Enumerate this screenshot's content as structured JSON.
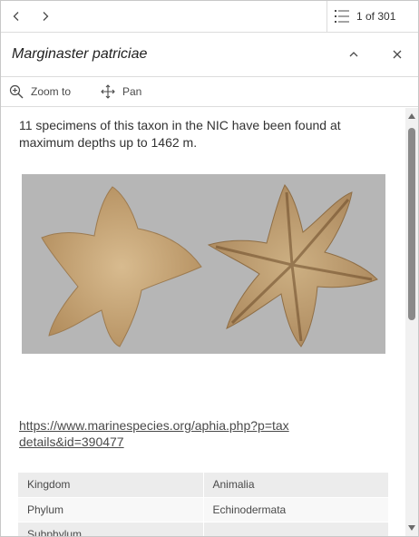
{
  "pager": {
    "prev_icon": "chevron-left-icon",
    "next_icon": "chevron-right-icon",
    "list_icon": "list-icon",
    "count_text": "1 of 301"
  },
  "header": {
    "title": "Marginaster patriciae",
    "collapse_icon": "chevron-up-icon",
    "close_icon": "close-icon"
  },
  "actions": {
    "zoom_label": "Zoom to",
    "pan_label": "Pan"
  },
  "content": {
    "description": "11 specimens of this taxon in the NIC have been found at maximum depths up to 1462 m.",
    "link_text": " https://www.marinespecies.org/aphia.php?p=taxdetails&id=390477",
    "attributes": [
      {
        "key": "Kingdom",
        "value": "Animalia"
      },
      {
        "key": "Phylum",
        "value": "Echinodermata"
      },
      {
        "key": "Subphylum",
        "value": ""
      }
    ]
  },
  "colors": {
    "border": "#c8c8c8",
    "photo_background": "#b6b6b6",
    "starfish": "#c9a77a",
    "scroll_thumb": "#8a8a8a"
  }
}
